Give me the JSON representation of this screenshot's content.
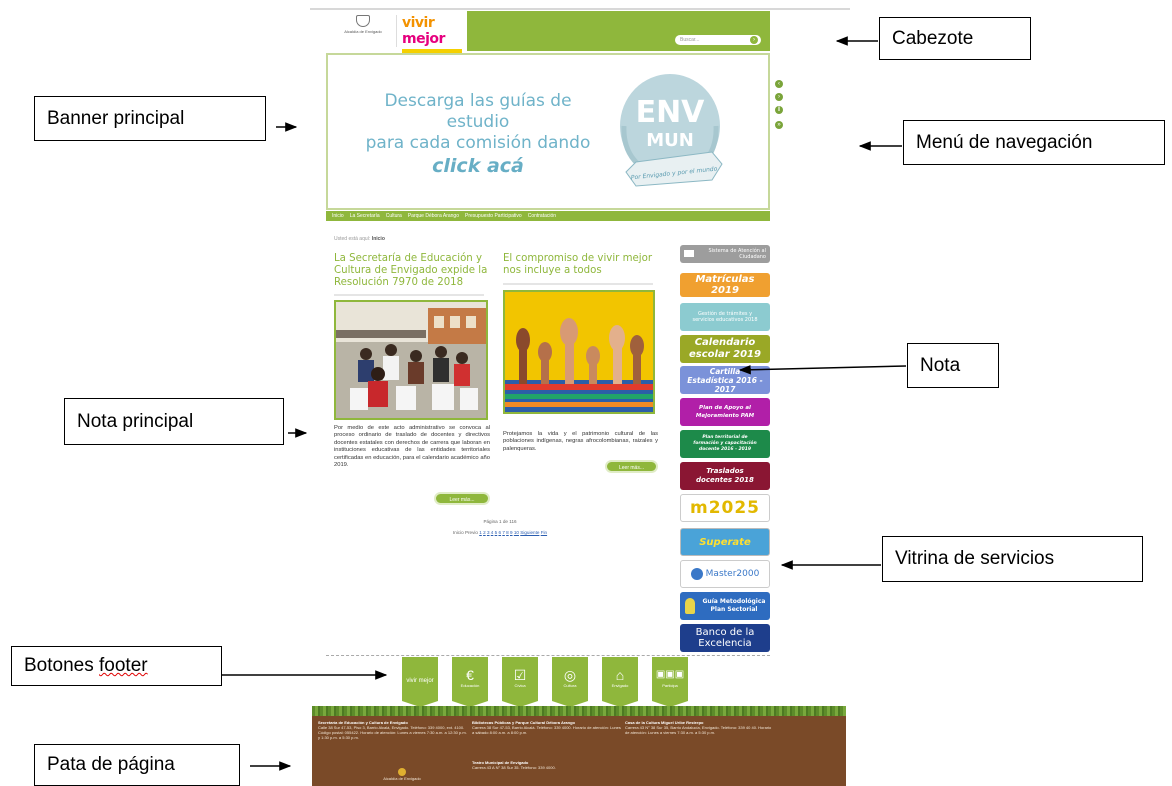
{
  "site": {
    "logo_text": "Alcaldía de Envigado",
    "brand_vivir": "vivir",
    "brand_mejor": "mejor",
    "search_placeholder": "Buscar...",
    "banner": {
      "line1": "Descarga las guías de estudio",
      "line2": "para cada comisión dando",
      "line3": "click acá",
      "badge_top": "ENV",
      "badge_mid": "MUN",
      "ribbon": "Por Envigado y por el mundo"
    },
    "menu": [
      "Inicio",
      "La Secretaría",
      "Cultura",
      "Parque Débora Arango",
      "Presupuesto Participativo",
      "Contratación"
    ],
    "breadcrumb_prefix": "Usted está aquí:",
    "breadcrumb_current": "Inicio",
    "article1": {
      "title": "La Secretaría de Educación y Cultura de Envigado expide la Resolución 7970 de 2018",
      "body": "Por medio de este acto administrativo se convoca al proceso ordinario de traslado de docentes y directivos docentes estatales con derechos de carrera que laboran en instituciones educativas de las entidades territoriales certificadas en educación, para el calendario académico año 2019.",
      "read_more": "Leer más..."
    },
    "article2": {
      "title": "El compromiso de vivir mejor nos incluye a todos",
      "body": "Protejamos la vida y el patrimonio cultural de las poblaciones indígenas, negras afrocolombianas, raizales y palenqueras.",
      "read_more": "Leer más..."
    },
    "pager": {
      "page_label": "Página 1 de 116",
      "start": "Inicio",
      "prev": "Previo",
      "pages": [
        "1",
        "2",
        "3",
        "4",
        "5",
        "6",
        "7",
        "8",
        "9",
        "10"
      ],
      "next": "Siguiente",
      "end": "Fin"
    },
    "sidebar": [
      {
        "text": "Sistema de Atención al Ciudadano",
        "color": "#9d9d9d"
      },
      {
        "text": "Matrículas 2019",
        "color": "#f0a030"
      },
      {
        "text": "Gestión de trámites y servicios educativos 2018",
        "color": "#8ccbd0"
      },
      {
        "text": "Calendario escolar 2019",
        "color": "#9aa826"
      },
      {
        "text": "Cartilla Estadística 2016 - 2017",
        "color": "#7b92d9"
      },
      {
        "text": "Plan de Apoyo al Mejoramiento PAM",
        "color": "#b11fa8"
      },
      {
        "text": "Plan territorial de formación y capacitación docente 2016 - 2019",
        "color": "#1d8a4a"
      },
      {
        "text": "Traslados docentes 2018",
        "color": "#8a1633"
      },
      {
        "text": "m2025",
        "color": "#ffffff"
      },
      {
        "text": "Superate",
        "color": "#4aa3d8"
      },
      {
        "text": "Master2000",
        "color": "#ffffff"
      },
      {
        "text": "Guía Metodológica Plan Sectorial",
        "color": "#2e6cc0"
      },
      {
        "text": "Banco de la Excelencia",
        "color": "#1e3e8c"
      }
    ],
    "footer_buttons": [
      "vivir mejor",
      "Educación",
      "Cívica",
      "Cultura",
      "Envigado",
      "Participa"
    ],
    "footer_cols": [
      {
        "title": "Secretaría de Educación y Cultura de Envigado",
        "text": "Calle 38 Sur 47-53, Piso 3, Barrio Alcalá, Envigado. Teléfono: 339 4000, ext. 4100. Código postal: 055422. Horario de atención: Lunes a viernes 7:30 a.m. a 12:30 p.m. y 1:30 p.m. a 5:30 p.m."
      },
      {
        "title": "Bibliotecas Públicas y Parque Cultural Débora Arango",
        "text": "Carrera 38 Sur 47-53, Barrio Alcalá. Teléfono: 339 4000. Horario de atención: Lunes a sábado 8:00 a.m. a 8:00 p.m."
      },
      {
        "title": "Casa de la Cultura Miguel Uribe Restrepo",
        "text": "Carrera 43 N° 38 Sur 35, Barrio Andalucía, Envigado. Teléfono: 339 40 40. Horario de atención: Lunes a viernes 7:30 a.m. a 5:30 p.m."
      }
    ],
    "footer_extra": {
      "title": "Teatro Municipal de Envigado",
      "text": "Carrera 43 A N° 38 Sur 35. Teléfono: 339 4000."
    },
    "footer_logo": "Alcaldía de Envigado"
  },
  "annotations": {
    "cabezote": "Cabezote",
    "banner_principal": "Banner principal",
    "menu_navegacion": "Menú de navegación",
    "nota": "Nota",
    "nota_principal": "Nota principal",
    "vitrina_servicios": "Vitrina de servicios",
    "botones_footer_1": "Botones",
    "botones_footer_2": "footer",
    "pata_pagina": "Pata de página"
  }
}
